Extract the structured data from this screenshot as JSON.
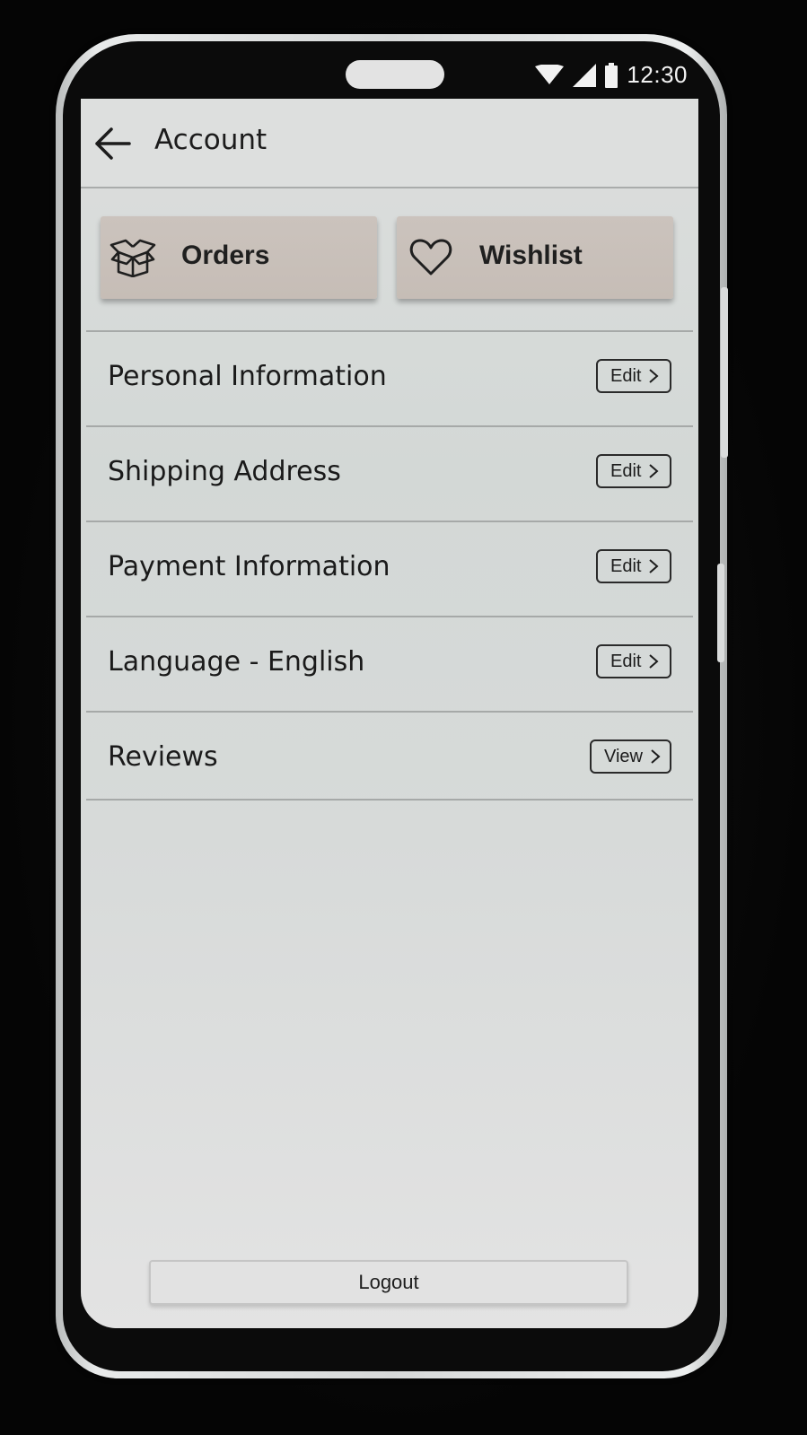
{
  "status_bar": {
    "time": "12:30",
    "icons": [
      "wifi-icon",
      "signal-icon",
      "battery-icon"
    ]
  },
  "header": {
    "back_icon": "arrow-left-icon",
    "title": "Account"
  },
  "quick_actions": [
    {
      "label": "Orders",
      "icon": "box-icon"
    },
    {
      "label": "Wishlist",
      "icon": "heart-icon"
    }
  ],
  "settings": [
    {
      "label": "Personal Information",
      "action": "Edit"
    },
    {
      "label": "Shipping Address",
      "action": "Edit"
    },
    {
      "label": "Payment Information",
      "action": "Edit"
    },
    {
      "label": "Language - English",
      "action": "Edit"
    },
    {
      "label": "Reviews",
      "action": "View"
    }
  ],
  "footer": {
    "logout_label": "Logout"
  },
  "colors": {
    "screen_bg": "#d7dad9",
    "quick_button_bg": "#c8bfb8",
    "text": "#1c1c1c",
    "divider": "#a6a9a8"
  }
}
